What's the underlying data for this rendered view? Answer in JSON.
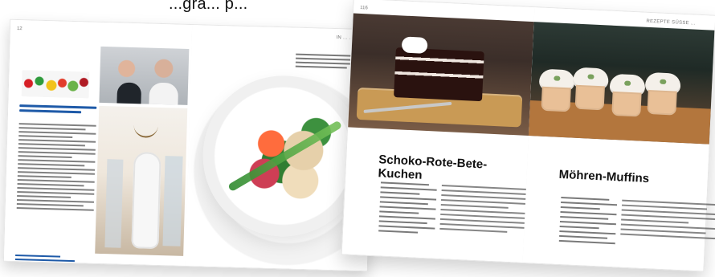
{
  "crop_caption": "...gra... p...",
  "left_spread": {
    "left_page_number": "12",
    "right_header": "IN ...  ...",
    "blue_title_lines": 2
  },
  "right_spread": {
    "left_page_number": "116",
    "right_header": "REZEPTE  SÜSSE ...",
    "recipe_left_title": "Schoko-Rote-Bete-Kuchen",
    "recipe_right_title": "Möhren-Muffins"
  }
}
